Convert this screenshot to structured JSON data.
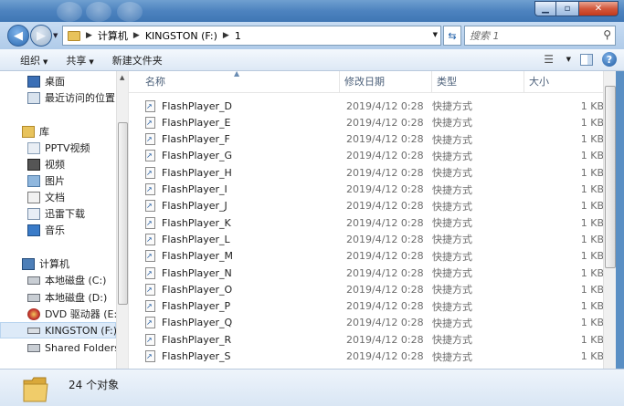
{
  "window": {
    "colors": {
      "frame": "#4d83bf",
      "close": "#c23a1d",
      "selection": "#ddeaf8"
    }
  },
  "address": {
    "crumbs": [
      "计算机",
      "KINGSTON (F:)",
      "1"
    ],
    "search_placeholder": "搜索 1"
  },
  "toolbar": {
    "organize": "组织",
    "share": "共享",
    "new_folder": "新建文件夹"
  },
  "nav": {
    "items": [
      {
        "label": "桌面",
        "icon": "desktop-icon"
      },
      {
        "label": "最近访问的位置",
        "icon": "recent-places-icon"
      },
      {
        "label": "库",
        "icon": "library-icon"
      },
      {
        "label": "PPTV视频",
        "icon": "pptv-video-icon"
      },
      {
        "label": "视频",
        "icon": "video-icon"
      },
      {
        "label": "图片",
        "icon": "picture-icon"
      },
      {
        "label": "文档",
        "icon": "document-icon"
      },
      {
        "label": "迅雷下载",
        "icon": "thunder-download-icon"
      },
      {
        "label": "音乐",
        "icon": "music-icon"
      },
      {
        "label": "计算机",
        "icon": "computer-icon"
      },
      {
        "label": "本地磁盘 (C:)",
        "icon": "local-disk-icon"
      },
      {
        "label": "本地磁盘 (D:)",
        "icon": "local-disk-icon"
      },
      {
        "label": "DVD 驱动器 (E:) V",
        "icon": "dvd-drive-icon"
      },
      {
        "label": "KINGSTON (F:)",
        "icon": "usb-drive-icon"
      },
      {
        "label": "Shared Folders (",
        "icon": "shared-folder-icon"
      }
    ]
  },
  "columns": {
    "name": "名称",
    "date": "修改日期",
    "type": "类型",
    "size": "大小"
  },
  "files": [
    {
      "name": "FlashPlayer_D",
      "date": "2019/4/12 0:28",
      "type": "快捷方式",
      "size": "1 KB"
    },
    {
      "name": "FlashPlayer_E",
      "date": "2019/4/12 0:28",
      "type": "快捷方式",
      "size": "1 KB"
    },
    {
      "name": "FlashPlayer_F",
      "date": "2019/4/12 0:28",
      "type": "快捷方式",
      "size": "1 KB"
    },
    {
      "name": "FlashPlayer_G",
      "date": "2019/4/12 0:28",
      "type": "快捷方式",
      "size": "1 KB"
    },
    {
      "name": "FlashPlayer_H",
      "date": "2019/4/12 0:28",
      "type": "快捷方式",
      "size": "1 KB"
    },
    {
      "name": "FlashPlayer_I",
      "date": "2019/4/12 0:28",
      "type": "快捷方式",
      "size": "1 KB"
    },
    {
      "name": "FlashPlayer_J",
      "date": "2019/4/12 0:28",
      "type": "快捷方式",
      "size": "1 KB"
    },
    {
      "name": "FlashPlayer_K",
      "date": "2019/4/12 0:28",
      "type": "快捷方式",
      "size": "1 KB"
    },
    {
      "name": "FlashPlayer_L",
      "date": "2019/4/12 0:28",
      "type": "快捷方式",
      "size": "1 KB"
    },
    {
      "name": "FlashPlayer_M",
      "date": "2019/4/12 0:28",
      "type": "快捷方式",
      "size": "1 KB"
    },
    {
      "name": "FlashPlayer_N",
      "date": "2019/4/12 0:28",
      "type": "快捷方式",
      "size": "1 KB"
    },
    {
      "name": "FlashPlayer_O",
      "date": "2019/4/12 0:28",
      "type": "快捷方式",
      "size": "1 KB"
    },
    {
      "name": "FlashPlayer_P",
      "date": "2019/4/12 0:28",
      "type": "快捷方式",
      "size": "1 KB"
    },
    {
      "name": "FlashPlayer_Q",
      "date": "2019/4/12 0:28",
      "type": "快捷方式",
      "size": "1 KB"
    },
    {
      "name": "FlashPlayer_R",
      "date": "2019/4/12 0:28",
      "type": "快捷方式",
      "size": "1 KB"
    },
    {
      "name": "FlashPlayer_S",
      "date": "2019/4/12 0:28",
      "type": "快捷方式",
      "size": "1 KB"
    }
  ],
  "status": {
    "count": "24 个对象"
  }
}
